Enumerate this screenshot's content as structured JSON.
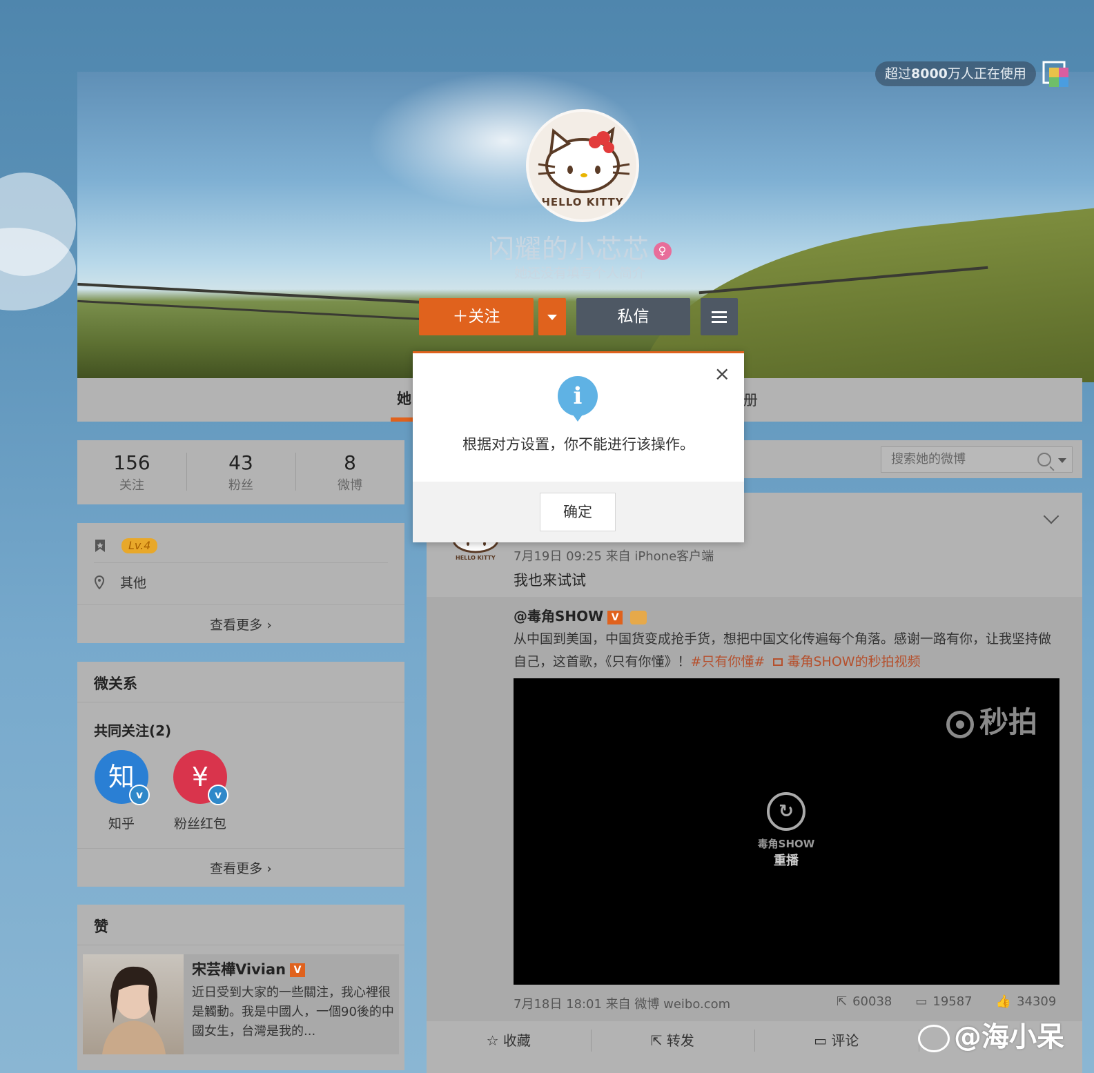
{
  "header": {
    "user_count_prefix": "超过",
    "user_count_value": "8000",
    "user_count_suffix": "万人正在使用"
  },
  "profile": {
    "nickname": "闪耀的小芯芯",
    "bio": "她还没有填写个人简介",
    "avatar_text": "HELLO KITTY",
    "follow_label": "关注",
    "message_label": "私信"
  },
  "tabs": {
    "active_partial": "她",
    "album_partial": "册"
  },
  "stats": [
    {
      "num": "156",
      "label": "关注"
    },
    {
      "num": "43",
      "label": "粉丝"
    },
    {
      "num": "8",
      "label": "微博"
    }
  ],
  "info": {
    "level": "Lv.4",
    "location": "其他",
    "more": "查看更多"
  },
  "relation": {
    "title": "微关系",
    "mutual_title": "共同关注(2)",
    "items": [
      {
        "name": "知乎",
        "glyph": "知",
        "color": "#2a7fd4"
      },
      {
        "name": "粉丝红包",
        "glyph": "¥",
        "color": "#d9344c"
      }
    ],
    "more": "查看更多"
  },
  "likes": {
    "title": "赞",
    "name": "宋芸樺Vivian",
    "text": "近日受到大家的一些關注，我心裡很是觸動。我是中國人，一個90後的中國女生，台灣是我的..."
  },
  "search": {
    "placeholder": "搜索她的微博"
  },
  "post": {
    "meta": "7月19日 09:25 来自 iPhone客户端",
    "text": "我也来试试",
    "repost_author": "@毒角SHOW",
    "repost_text_1": "从中国到美国，中国货变成抢手货，想把中国文化传遍每个角落。感谢一路有你，让我坚持做自己，这首歌，《只有你懂》！",
    "topic": "#只有你懂#",
    "video_link": "毒角SHOW的秒拍视频",
    "video_brand": "秒拍",
    "replay_brand": "毒角SHOW",
    "replay_label": "重播",
    "repost_meta": "7月18日 18:01 来自 微博 weibo.com",
    "forward_count": "60038",
    "comment_count": "19587",
    "like_count": "34309"
  },
  "actions": [
    "收藏",
    "转发",
    "评论",
    ""
  ],
  "watermark": "@海小呆",
  "dialog": {
    "message": "根据对方设置，你不能进行该操作。",
    "ok": "确定",
    "close": "×"
  }
}
